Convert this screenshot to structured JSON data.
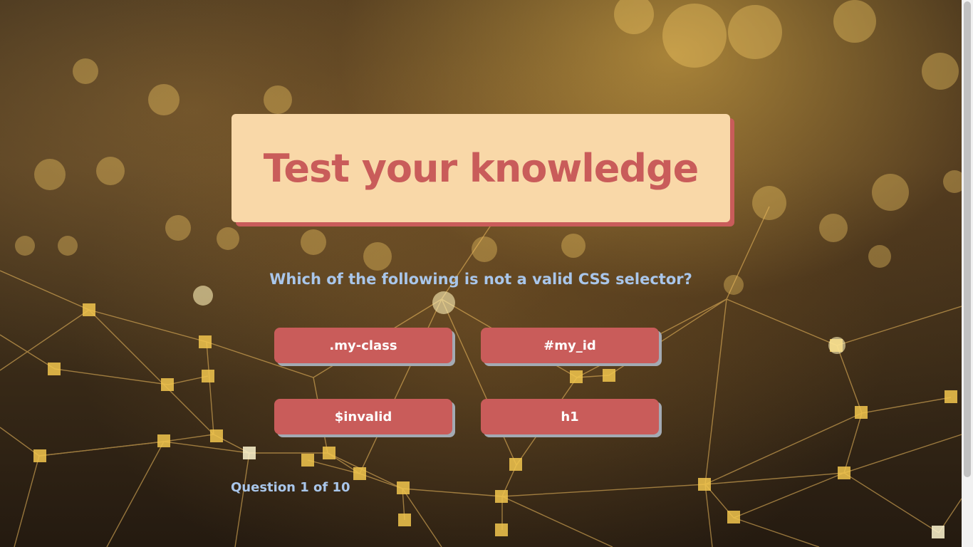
{
  "header": {
    "title": "Test your knowledge"
  },
  "quiz": {
    "question": "Which of the following is not a valid CSS selector?",
    "answers": [
      ".my-class",
      "#my_id",
      "$invalid",
      "h1"
    ],
    "progress_text": "Question 1 of 10"
  },
  "colors": {
    "card_background": "#f9d8a8",
    "accent": "#c95c5a",
    "question_text": "#a9c6ea",
    "button_shadow": "#a3aab3"
  },
  "icons": {
    "background": "network-bokeh-image"
  }
}
